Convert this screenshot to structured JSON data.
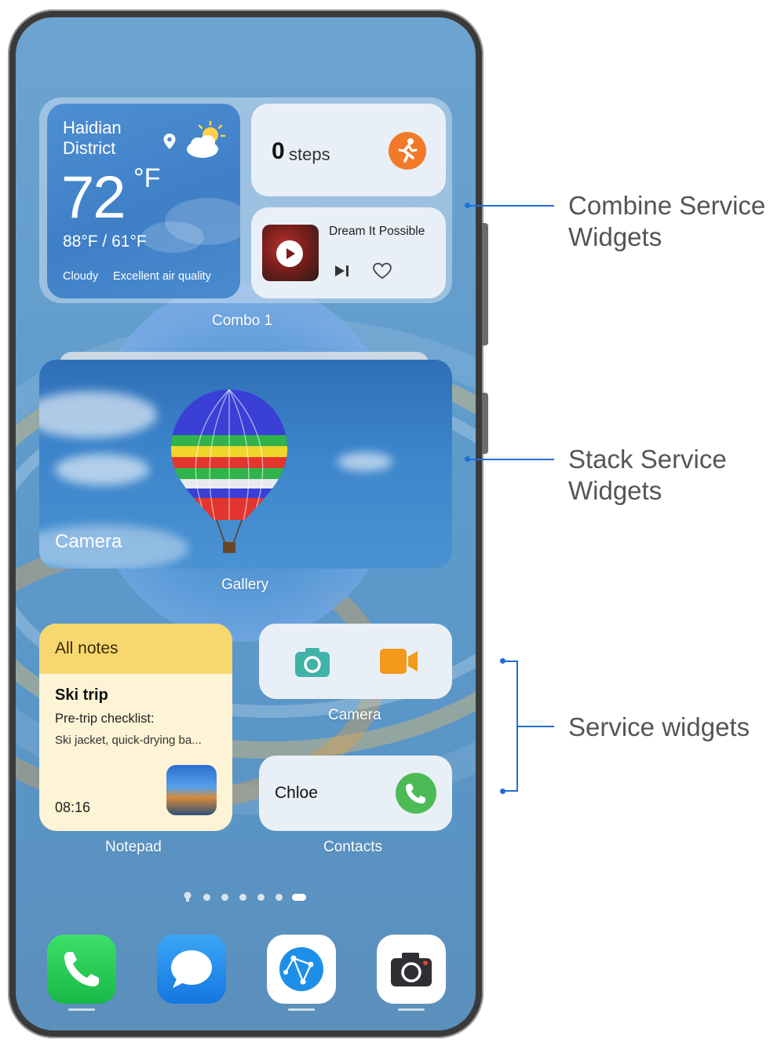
{
  "weather": {
    "location_line1": "Haidian",
    "location_line2": "District",
    "temperature": "72",
    "unit": "°F",
    "range": "88°F / 61°F",
    "condition": "Cloudy",
    "air_quality": "Excellent air quality"
  },
  "steps": {
    "count": "0",
    "label": "steps"
  },
  "music": {
    "title": "Dream It Possible"
  },
  "combo_label": "Combo 1",
  "gallery": {
    "caption": "Camera",
    "label": "Gallery"
  },
  "notes": {
    "header": "All notes",
    "title": "Ski trip",
    "line1": "Pre-trip checklist:",
    "line2": "Ski jacket, quick-drying ba...",
    "time": "08:16",
    "label": "Notepad"
  },
  "camera_widget": {
    "label": "Camera"
  },
  "contacts_widget": {
    "name": "Chloe",
    "label": "Contacts"
  },
  "page_dots": {
    "count": 7,
    "active": 7
  },
  "dock": [
    "phone-icon",
    "messages-icon",
    "browser-icon",
    "camera-icon"
  ],
  "annotations": {
    "combine_line1": "Combine Service",
    "combine_line2": "Widgets",
    "stack_line1": "Stack Service",
    "stack_line2": "Widgets",
    "service": "Service widgets"
  },
  "colors": {
    "annotation_blue": "#1f6fd6",
    "steps_orange": "#f07a2a",
    "call_green": "#4cbb55",
    "notes_yellow": "#f7d870"
  }
}
